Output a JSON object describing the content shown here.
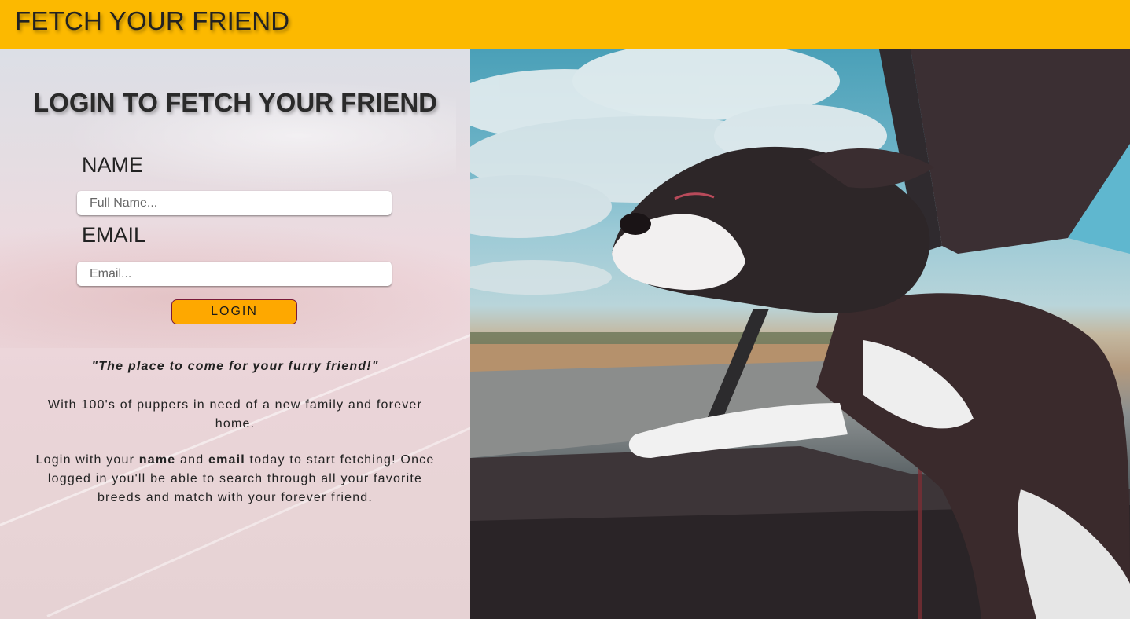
{
  "header": {
    "title": "FETCH YOUR FRIEND"
  },
  "login": {
    "title": "LOGIN TO FETCH YOUR FRIEND",
    "name_label": "NAME",
    "name_placeholder": "Full Name...",
    "name_value": "",
    "email_label": "EMAIL",
    "email_placeholder": "Email...",
    "email_value": "",
    "button_label": "LOGIN"
  },
  "copy": {
    "tagline": "\"The place to come for your furry friend!\"",
    "paragraph_1": "With 100's of puppers in need of a new family and forever home.",
    "paragraph_2_pre": "Login with your ",
    "paragraph_2_name": "name",
    "paragraph_2_mid": " and ",
    "paragraph_2_email": "email",
    "paragraph_2_post": " today to start fetching! Once logged in you'll be able to search through all your favorite breeds and match with your forever friend."
  },
  "colors": {
    "header_bg": "#fcb900",
    "button_bg": "#fea800",
    "button_border": "#7a1a3a"
  },
  "hero_image": {
    "icon": "dog-in-car-window-photo"
  }
}
